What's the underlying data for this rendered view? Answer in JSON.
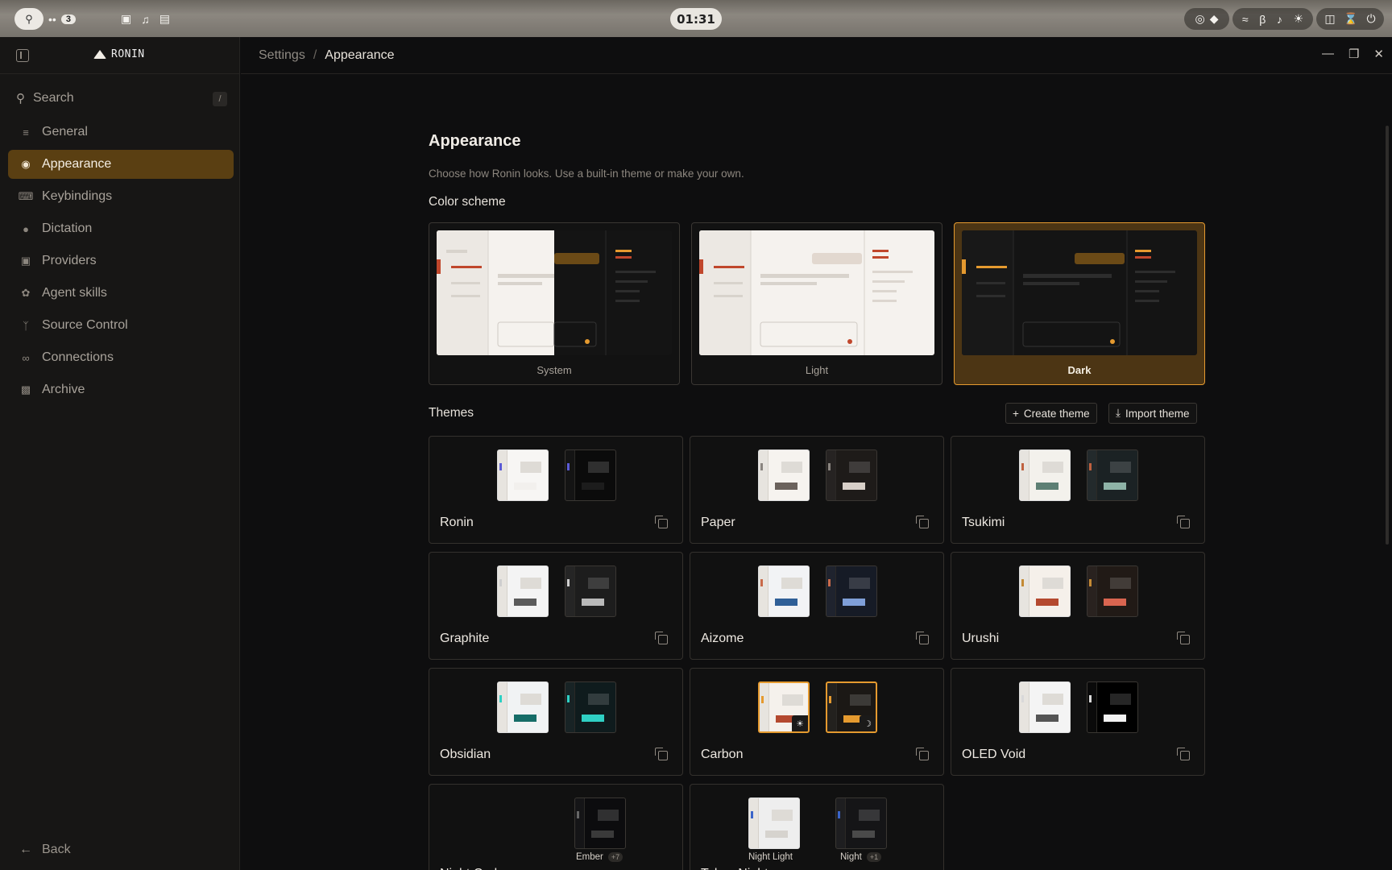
{
  "system": {
    "clock": "01:31",
    "workspace_count": "3"
  },
  "sidebar": {
    "app_name": "RONIN",
    "search_placeholder": "Search",
    "search_shortcut": "/",
    "items": [
      {
        "label": "General",
        "icon": "sliders-icon",
        "active": false
      },
      {
        "label": "Appearance",
        "icon": "palette-icon",
        "active": true
      },
      {
        "label": "Keybindings",
        "icon": "keyboard-icon",
        "active": false
      },
      {
        "label": "Dictation",
        "icon": "microphone-icon",
        "active": false
      },
      {
        "label": "Providers",
        "icon": "robot-icon",
        "active": false
      },
      {
        "label": "Agent skills",
        "icon": "skills-icon",
        "active": false
      },
      {
        "label": "Source Control",
        "icon": "branch-icon",
        "active": false
      },
      {
        "label": "Connections",
        "icon": "link-icon",
        "active": false
      },
      {
        "label": "Archive",
        "icon": "archive-icon",
        "active": false
      }
    ],
    "back_label": "Back"
  },
  "breadcrumb": {
    "root": "Settings",
    "current": "Appearance"
  },
  "page": {
    "title": "Appearance",
    "description": "Choose how Ronin looks. Use a built-in theme or make your own.",
    "color_scheme_heading": "Color scheme",
    "schemes": [
      {
        "label": "System",
        "selected": false
      },
      {
        "label": "Light",
        "selected": false
      },
      {
        "label": "Dark",
        "selected": true
      }
    ],
    "themes_heading": "Themes",
    "create_theme_label": "Create theme",
    "import_theme_label": "Import theme",
    "themes": [
      {
        "name": "Ronin",
        "accent": "#5b5bd6",
        "light_bar": "#f2f0ed",
        "dark_bar": "#1c1c1c",
        "dark_bg": "#0b0b0b",
        "light_bg": "#f7f6f4"
      },
      {
        "name": "Paper",
        "accent": "#8a8580",
        "light_bar": "#6b625c",
        "dark_bar": "#d7cfc8",
        "dark_bg": "#1e1b19",
        "light_bg": "#f6f3ef"
      },
      {
        "name": "Tsukimi",
        "accent": "#c0613f",
        "light_bar": "#5d7f74",
        "dark_bar": "#8eb3a7",
        "dark_bg": "#1b2224",
        "light_bg": "#f3f1ec"
      },
      {
        "name": "Graphite",
        "accent": "#cfcfcf",
        "light_bar": "#5b5b5b",
        "dark_bar": "#b9b9b9",
        "dark_bg": "#1d1d1d",
        "light_bg": "#f4f4f4"
      },
      {
        "name": "Aizome",
        "accent": "#c96a4a",
        "light_bar": "#2f5f97",
        "dark_bar": "#7f9fd8",
        "dark_bg": "#161b26",
        "light_bg": "#f2f3f5"
      },
      {
        "name": "Urushi",
        "accent": "#c48a34",
        "light_bar": "#b4492f",
        "dark_bar": "#d96550",
        "dark_bg": "#211a16",
        "light_bg": "#f5f0ea"
      },
      {
        "name": "Obsidian",
        "accent": "#2fd0c4",
        "light_bar": "#166d68",
        "dark_bar": "#2fd0c4",
        "dark_bg": "#0f1b1d",
        "light_bg": "#f1f3f4"
      },
      {
        "name": "Carbon",
        "accent": "#e59a2f",
        "light_bar": "#b4492f",
        "dark_bar": "#e59a2f",
        "dark_bg": "#1b1815",
        "light_bg": "#f5f1ec",
        "selected": true
      },
      {
        "name": "OLED Void",
        "accent": "#d9d9d9",
        "light_bar": "#555555",
        "dark_bar": "#f2f2f2",
        "dark_bg": "#000000",
        "light_bg": "#f4f4f4"
      },
      {
        "name": "Night Coder",
        "variant_dark": "Ember",
        "variant_dark_count": "+7",
        "custom": true
      },
      {
        "name": "Tokyo Night",
        "variant_light": "Night Light",
        "variant_dark": "Night",
        "variant_dark_count": "+1",
        "custom": true
      }
    ]
  }
}
